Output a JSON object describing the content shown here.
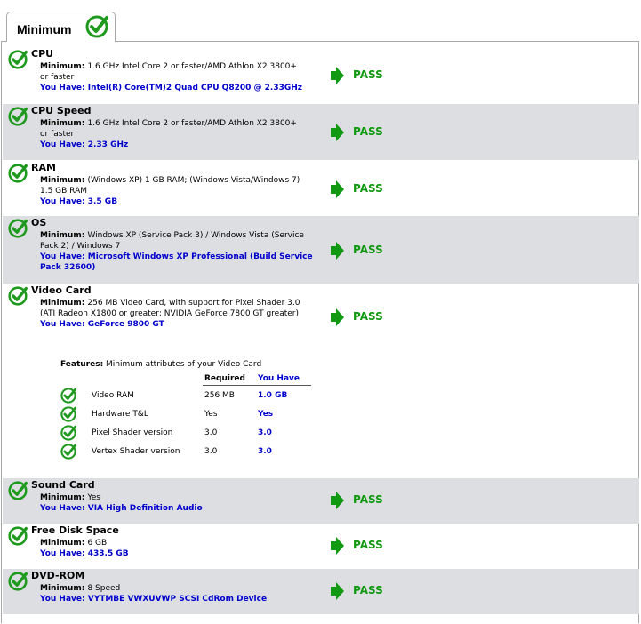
{
  "tab": {
    "label": "Minimum",
    "icon": "check-icon"
  },
  "colors": {
    "check_green": "#1f9a1f",
    "pass_green": "#119911",
    "have_blue": "#0000cc",
    "shade": "#dddee2"
  },
  "labels": {
    "minimum": "Minimum:",
    "you_have": "You Have:",
    "pass": "PASS"
  },
  "items": [
    {
      "title": "CPU",
      "minimum": "1.6 GHz Intel Core 2 or faster/AMD Athlon X2 3800+ or faster",
      "have": "Intel(R) Core(TM)2 Quad CPU Q8200 @ 2.33GHz"
    },
    {
      "title": "CPU Speed",
      "minimum": "1.6 GHz Intel Core 2 or faster/AMD Athlon X2 3800+ or faster",
      "have": "2.33 GHz"
    },
    {
      "title": "RAM",
      "minimum": "(Windows XP) 1 GB RAM; (Windows Vista/Windows 7) 1.5 GB RAM",
      "have": "3.5 GB"
    },
    {
      "title": "OS",
      "minimum": "Windows XP (Service Pack 3) / Windows Vista (Service Pack 2) / Windows 7",
      "have": "Microsoft Windows XP Professional (Build Service Pack 32600)"
    },
    {
      "title": "Video Card",
      "minimum": "256 MB Video Card, with support for Pixel Shader 3.0 (ATI Radeon X1800 or greater; NVIDIA GeForce 7800 GT greater)",
      "have": "GeForce 9800 GT"
    },
    {
      "title": "Sound Card",
      "minimum": "Yes",
      "have": "VIA High Definition Audio"
    },
    {
      "title": "Free Disk Space",
      "minimum": "6 GB",
      "have": "433.5 GB"
    },
    {
      "title": "DVD-ROM",
      "minimum": "8 Speed",
      "have": "VYTMBE VWXUVWP SCSI CdRom Device"
    }
  ],
  "features": {
    "label": "Features:",
    "description": "Minimum attributes of your Video Card",
    "col_required": "Required",
    "col_have": "You Have",
    "rows": [
      {
        "name": "Video RAM",
        "required": "256 MB",
        "have": "1.0 GB"
      },
      {
        "name": "Hardware T&L",
        "required": "Yes",
        "have": "Yes"
      },
      {
        "name": "Pixel Shader version",
        "required": "3.0",
        "have": "3.0"
      },
      {
        "name": "Vertex Shader version",
        "required": "3.0",
        "have": "3.0"
      }
    ]
  }
}
